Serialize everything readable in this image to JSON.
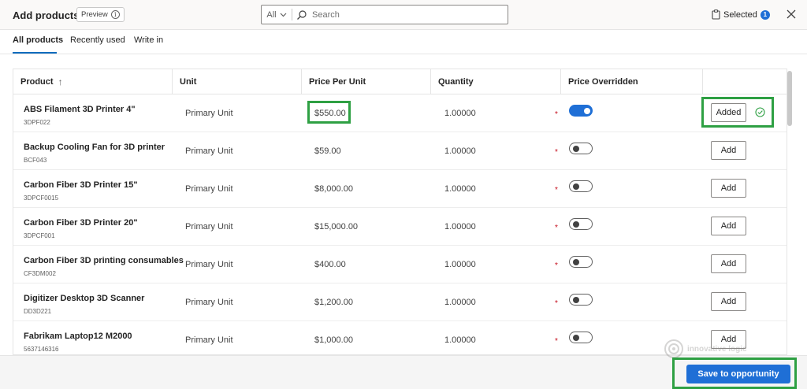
{
  "header": {
    "title": "Add products",
    "preview_label": "Preview",
    "search": {
      "scope": "All",
      "placeholder": "Search"
    },
    "selected_label": "Selected",
    "selected_count": "1"
  },
  "tabs": [
    {
      "label": "All products",
      "active": true
    },
    {
      "label": "Recently used",
      "active": false
    },
    {
      "label": "Write in",
      "active": false
    }
  ],
  "columns": {
    "product": "Product",
    "unit": "Unit",
    "price": "Price Per Unit",
    "quantity": "Quantity",
    "override": "Price Overridden"
  },
  "rows": [
    {
      "name": "ABS Filament 3D Printer 4\"",
      "code": "3DPF022",
      "unit": "Primary Unit",
      "price": "$550.00",
      "qty": "1.00000",
      "overridden": true,
      "action": "Added"
    },
    {
      "name": "Backup Cooling Fan for 3D printer",
      "code": "BCF043",
      "unit": "Primary Unit",
      "price": "$59.00",
      "qty": "1.00000",
      "overridden": false,
      "action": "Add"
    },
    {
      "name": "Carbon Fiber 3D Printer 15\"",
      "code": "3DPCF0015",
      "unit": "Primary Unit",
      "price": "$8,000.00",
      "qty": "1.00000",
      "overridden": false,
      "action": "Add"
    },
    {
      "name": "Carbon Fiber 3D Printer 20\"",
      "code": "3DPCF001",
      "unit": "Primary Unit",
      "price": "$15,000.00",
      "qty": "1.00000",
      "overridden": false,
      "action": "Add"
    },
    {
      "name": "Carbon Fiber 3D printing consumables",
      "code": "CF3DM002",
      "unit": "Primary Unit",
      "price": "$400.00",
      "qty": "1.00000",
      "overridden": false,
      "action": "Add"
    },
    {
      "name": "Digitizer Desktop 3D Scanner",
      "code": "DD3D221",
      "unit": "Primary Unit",
      "price": "$1,200.00",
      "qty": "1.00000",
      "overridden": false,
      "action": "Add"
    },
    {
      "name": "Fabrikam Laptop12 M2000",
      "code": "5637146316",
      "unit": "Primary Unit",
      "price": "$1,000.00",
      "qty": "1.00000",
      "overridden": false,
      "action": "Add"
    }
  ],
  "footer": {
    "save_label": "Save to opportunity"
  },
  "watermark": "innovative logic",
  "colors": {
    "accent": "#1f6fd6",
    "highlight": "#2ea043",
    "required": "#c50f1f"
  }
}
